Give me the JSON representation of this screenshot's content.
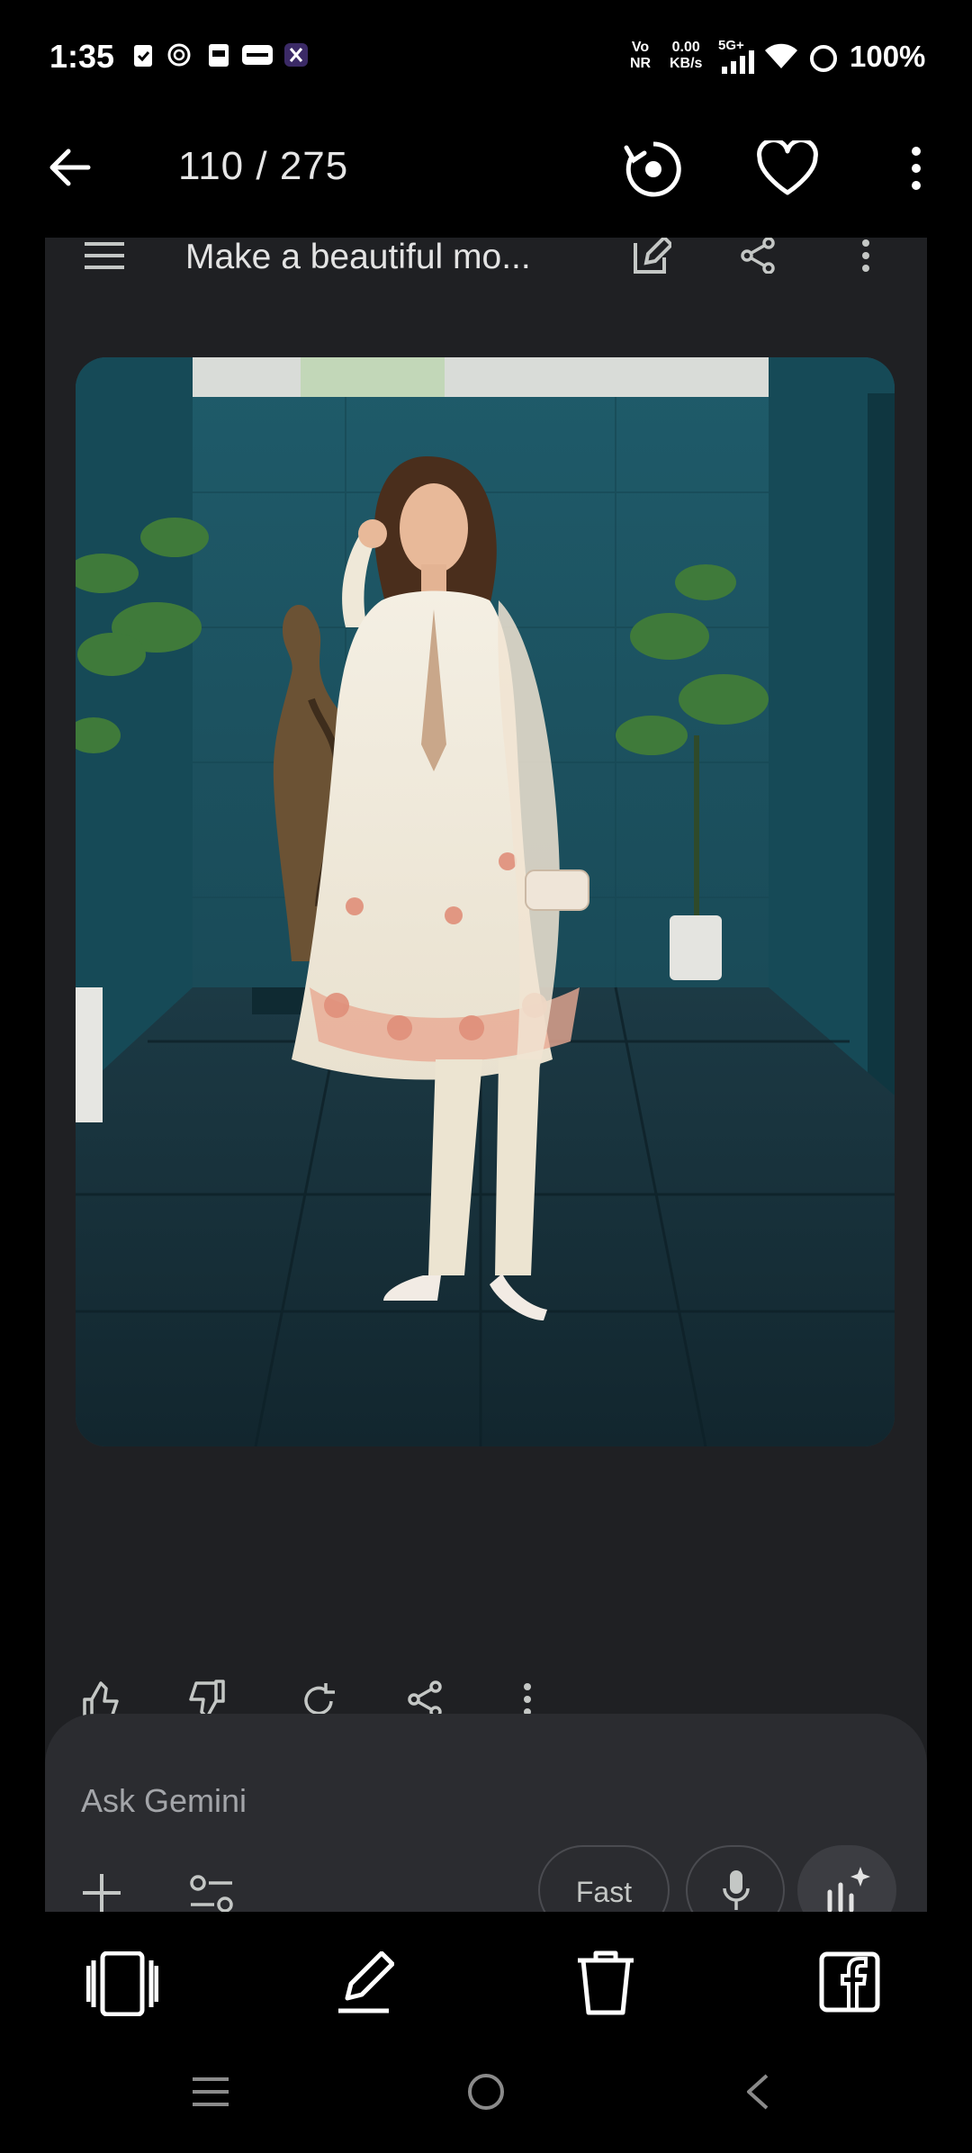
{
  "status_bar": {
    "time": "1:35",
    "network_label_top": "Vo",
    "network_label_bottom": "NR",
    "speed_value": "0.00",
    "speed_unit": "KB/s",
    "signal_label": "5G+",
    "battery": "100%",
    "notification_icons": [
      "checklist-icon",
      "chatgpt-icon",
      "pdf-icon",
      "paytm-icon",
      "app-icon"
    ]
  },
  "viewer_header": {
    "counter": "110 / 275",
    "icons": [
      "back-arrow-icon",
      "rotate-icon",
      "heart-icon",
      "more-vert-icon"
    ]
  },
  "embedded_screenshot": {
    "chat_title": "Make a beautiful mo...",
    "header_icons": [
      "menu-icon",
      "edit-icon",
      "share-icon",
      "more-vert-icon"
    ],
    "generated_image_description_icon": "photo",
    "response_actions": [
      "thumbs-up-icon",
      "thumbs-down-icon",
      "regenerate-icon",
      "share-icon",
      "more-vert-icon"
    ],
    "input_placeholder": "Ask Gemini",
    "mode_button": "Fast",
    "input_icons": [
      "plus-icon",
      "tools-icon",
      "mic-icon",
      "spark-icon"
    ]
  },
  "bottom_toolbar": {
    "icons": [
      "slideshow-icon",
      "edit-pencil-icon",
      "delete-icon",
      "facebook-icon"
    ]
  },
  "nav_bar": {
    "icons": [
      "recents-icon",
      "home-icon",
      "back-icon"
    ]
  },
  "colors": {
    "background": "#000000",
    "panel": "#1f2023",
    "input_panel": "#2b2c30",
    "wall_teal": "#1c5563",
    "floor": "#1d3a44"
  }
}
